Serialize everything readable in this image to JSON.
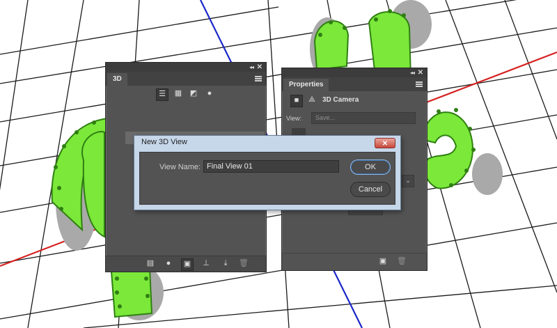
{
  "panel_3d": {
    "tab_label": "3D",
    "collapse_glyph": "◂◂",
    "close_glyph": "✕",
    "filter_icons": [
      "scene-filter-icon",
      "mesh-filter-icon",
      "material-filter-icon",
      "light-filter-icon"
    ],
    "bottom_icons": [
      "render-icon",
      "add-light-icon",
      "camera-view-icon",
      "drop-to-plane-icon",
      "add-object-icon",
      "trash-icon"
    ]
  },
  "panel_properties": {
    "tab_label": "Properties",
    "collapse_glyph": "◂◂",
    "close_glyph": "✕",
    "header_label": "3D Camera",
    "view_label": "View:",
    "view_placeholder": "Save...",
    "bottom_icons": [
      "camera-settings-icon",
      "trash-icon"
    ]
  },
  "dialog": {
    "title": "New 3D View",
    "close_glyph": "✕",
    "view_name_label": "View Name:",
    "view_name_value": "Final View 01",
    "ok_label": "OK",
    "cancel_label": "Cancel"
  },
  "colors": {
    "panel_bg": "#535353",
    "dialog_frame": "#c7d7ea",
    "grid_line": "#1a1a1a",
    "axis_red": "#d62020",
    "axis_blue": "#1a27c8",
    "cactus_green": "#7be83a"
  }
}
